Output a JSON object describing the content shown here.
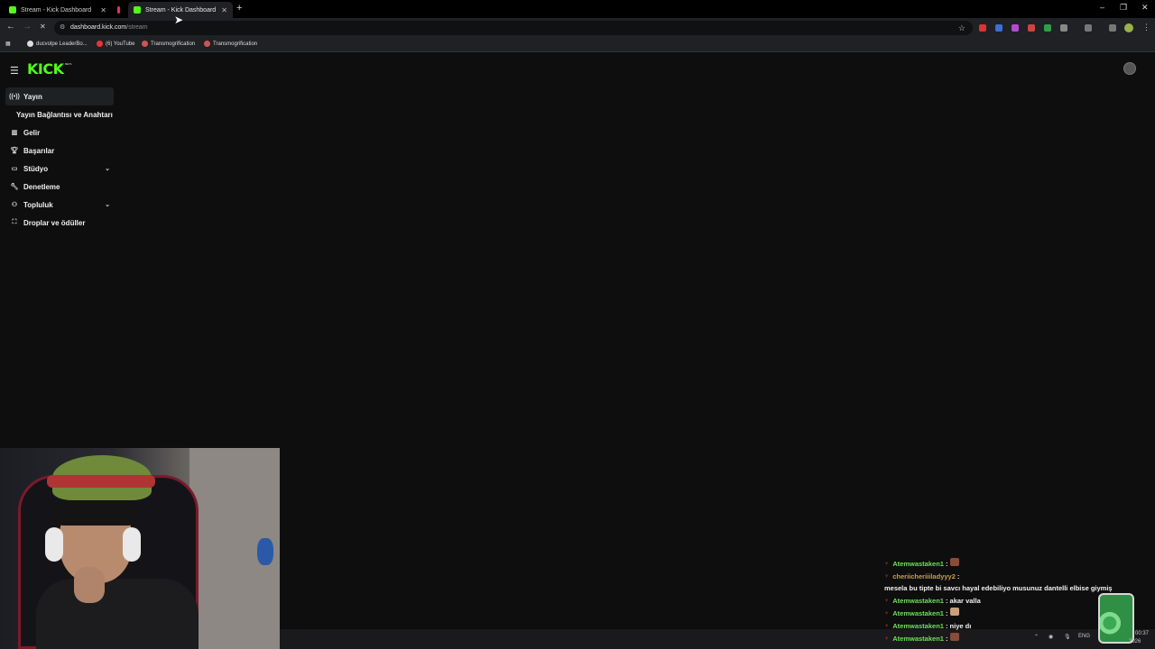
{
  "browser": {
    "tabs": [
      {
        "title": "Stream - Kick Dashboard",
        "active": false,
        "color": "#53fc18"
      },
      {
        "title": "",
        "active": false,
        "color": "#e1306c"
      },
      {
        "title": "Stream - Kick Dashboard",
        "active": true,
        "color": "#53fc18"
      }
    ],
    "url_host": "dashboard.kick.com",
    "url_path": "/stream",
    "bookmarks": [
      "ducvolpe LeaderBo...",
      "(6) YouTube",
      "Transmogrification",
      "Transmogrification"
    ]
  },
  "app": {
    "logo": "KICK",
    "beta": "BETA",
    "accent": "#53fc18"
  },
  "sidebar": {
    "items": [
      {
        "label": "Yayın",
        "icon": "broadcast-icon",
        "active": true
      },
      {
        "label": "Yayın Bağlantısı ve Anahtarı",
        "icon": "",
        "sub": true
      },
      {
        "label": "Gelir",
        "icon": "chart-icon"
      },
      {
        "label": "Başarılar",
        "icon": "trophy-icon"
      },
      {
        "label": "Stüdyo",
        "icon": "studio-icon",
        "expandable": true
      },
      {
        "label": "Denetleme",
        "icon": "wrench-icon"
      },
      {
        "label": "Topluluk",
        "icon": "community-icon",
        "expandable": true
      },
      {
        "label": "Droplar ve ödüller",
        "icon": "gift-icon"
      }
    ]
  },
  "chat": {
    "messages": [
      {
        "user": "Atemwastaken1",
        "text": "",
        "emote": true
      },
      {
        "user": "cheriicheriiiladyyy2",
        "text": "mesela bu tipte bi savcı hayal edebiliyo musunuz dantelli elbise giymiş",
        "alt": true
      },
      {
        "user": "Atemwastaken1",
        "text": "akar valla"
      },
      {
        "user": "Atemwastaken1",
        "text": "",
        "emote": true
      },
      {
        "user": "Atemwastaken1",
        "text": "niye dı"
      },
      {
        "user": "Atemwastaken1",
        "text": "",
        "emote": true
      }
    ]
  },
  "tray": {
    "lang": "ENG",
    "time": "00:37",
    "date": "...2026"
  }
}
